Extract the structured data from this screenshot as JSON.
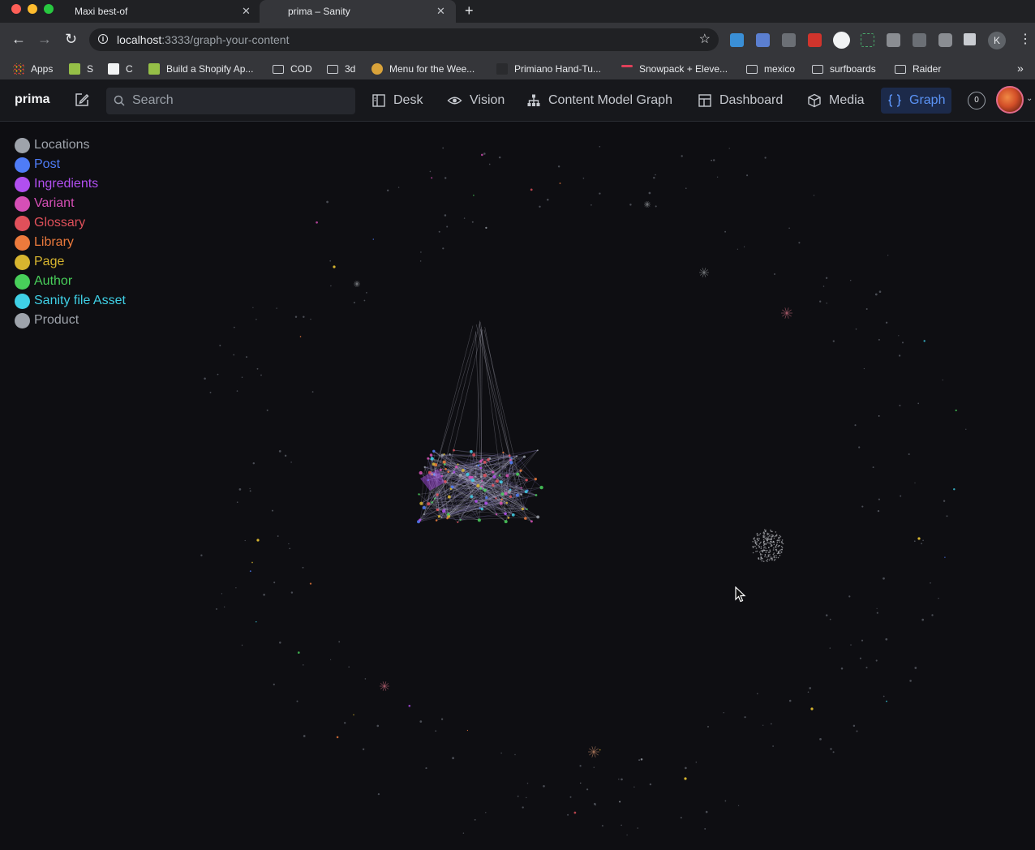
{
  "browser": {
    "tabs": [
      {
        "title": "Maxi best-of",
        "close": "✕",
        "active": false
      },
      {
        "title": "prima – Sanity",
        "close": "✕",
        "active": true
      }
    ],
    "new_tab": "+",
    "url_host": "localhost",
    "url_path": ":3333/graph-your-content",
    "bookmarks": [
      {
        "label": "Apps",
        "icon": "apps-grid-icon"
      },
      {
        "label": "S",
        "icon": "shopify-icon"
      },
      {
        "label": "C",
        "icon": "c-logo-icon"
      },
      {
        "label": "Build a Shopify Ap...",
        "icon": "shopify-icon"
      },
      {
        "label": "COD",
        "icon": "folder-icon"
      },
      {
        "label": "3d",
        "icon": "folder-icon"
      },
      {
        "label": "Menu for the Wee...",
        "icon": "menu-site-icon"
      },
      {
        "label": "Primiano Hand-Tu...",
        "icon": "am-logo-icon"
      },
      {
        "label": "Snowpack + Eleve...",
        "icon": "snowpack-icon"
      },
      {
        "label": "mexico",
        "icon": "folder-icon"
      },
      {
        "label": "surfboards",
        "icon": "folder-icon"
      },
      {
        "label": "Raider",
        "icon": "folder-icon"
      }
    ],
    "bookmarks_more": "»",
    "profile_initial": "K"
  },
  "studio": {
    "brand": "prima",
    "search_placeholder": "Search",
    "nav": [
      {
        "label": "Desk",
        "icon": "desk-icon",
        "active": false
      },
      {
        "label": "Vision",
        "icon": "eye-icon",
        "active": false
      },
      {
        "label": "Content Model Graph",
        "icon": "tree-icon",
        "active": false
      },
      {
        "label": "Dashboard",
        "icon": "dashboard-icon",
        "active": false
      },
      {
        "label": "Media",
        "icon": "cube-icon",
        "active": false
      },
      {
        "label": "Graph",
        "icon": "braces-icon",
        "active": true
      }
    ],
    "presence_count": "0"
  },
  "legend": [
    {
      "label": "Locations",
      "color": "#9ea3ab"
    },
    {
      "label": "Post",
      "color": "#4f7cf7"
    },
    {
      "label": "Ingredients",
      "color": "#b14ff0"
    },
    {
      "label": "Variant",
      "color": "#d64fb6"
    },
    {
      "label": "Glossary",
      "color": "#e0505a"
    },
    {
      "label": "Library",
      "color": "#ec7a3c"
    },
    {
      "label": "Page",
      "color": "#d7b52f"
    },
    {
      "label": "Author",
      "color": "#48cf5a"
    },
    {
      "label": "Sanity file Asset",
      "color": "#3fd0e6"
    },
    {
      "label": "Product",
      "color": "#9ea3ab"
    }
  ]
}
